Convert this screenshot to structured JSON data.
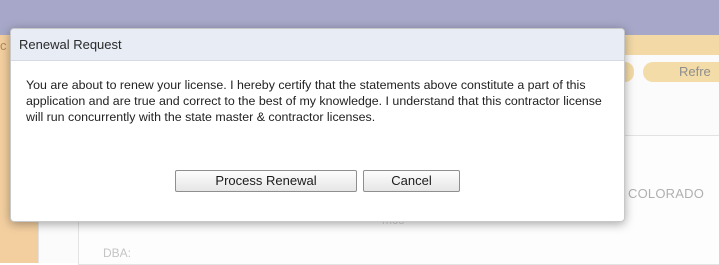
{
  "background": {
    "left_partial_letter": "c",
    "refresh_label": "Refre",
    "state_text": "COLORADO",
    "faint_text": "mco",
    "dba_label": "DBA:"
  },
  "dialog": {
    "title": "Renewal Request",
    "message": "You are about to renew your license. I hereby certify that the statements above constitute a part of this application and are true and correct to the best of my knowledge. I understand that this contractor license will run concurrently with the state master & contractor licenses.",
    "buttons": {
      "process_label": "Process Renewal",
      "cancel_label": "Cancel"
    }
  },
  "colors": {
    "top_band": "#a7a8c9",
    "accent_tan": "#f3d9a6",
    "dialog_titlebar": "#e7ecf5"
  }
}
